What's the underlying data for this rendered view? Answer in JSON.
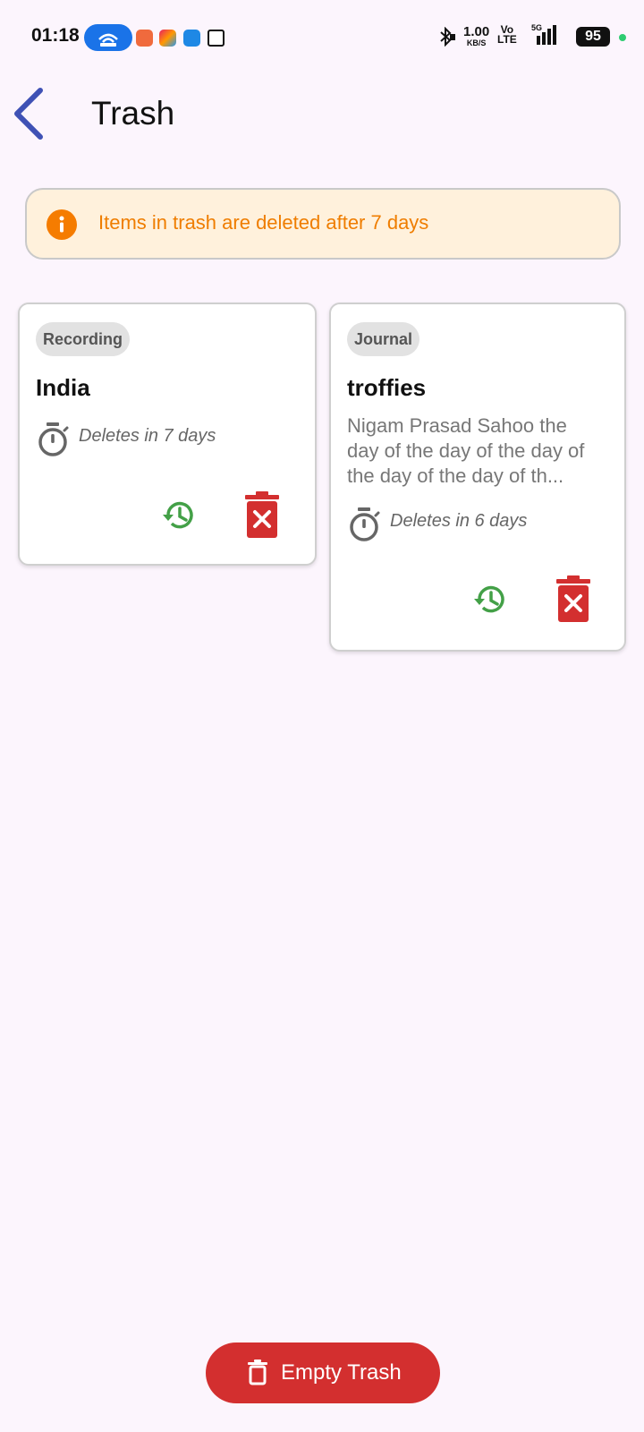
{
  "status_bar": {
    "time": "01:18",
    "net_speed_value": "1.00",
    "net_speed_unit": "KB/S",
    "volte_top": "Vo",
    "volte_bottom": "LTE",
    "signal_label": "5G",
    "battery": "95",
    "icons": [
      "hotspot-icon",
      "app-notification-icons",
      "bluetooth-icon",
      "signal-icon",
      "battery-icon"
    ]
  },
  "header": {
    "title": "Trash",
    "back_icon": "chevron-left-icon"
  },
  "info_banner": {
    "icon": "info-icon",
    "text": "Items in trash are deleted after 7 days"
  },
  "cards": [
    {
      "category": "Recording",
      "title": "India",
      "preview": "",
      "deletes_text": "Deletes in 7 days"
    },
    {
      "category": "Journal",
      "title": "troffies",
      "preview": "Nigam Prasad Sahoo the day of the day of the day of the day of the day of th...",
      "deletes_text": "Deletes in 6 days"
    }
  ],
  "footer": {
    "empty_trash_label": "Empty Trash",
    "empty_trash_icon": "trash-icon"
  },
  "colors": {
    "background": "#fcf5fd",
    "accent_blue": "#3f51b5",
    "banner_background": "#fff1dc",
    "banner_text": "#ef7d00",
    "restore_green": "#43a047",
    "delete_red": "#d32f2f"
  }
}
